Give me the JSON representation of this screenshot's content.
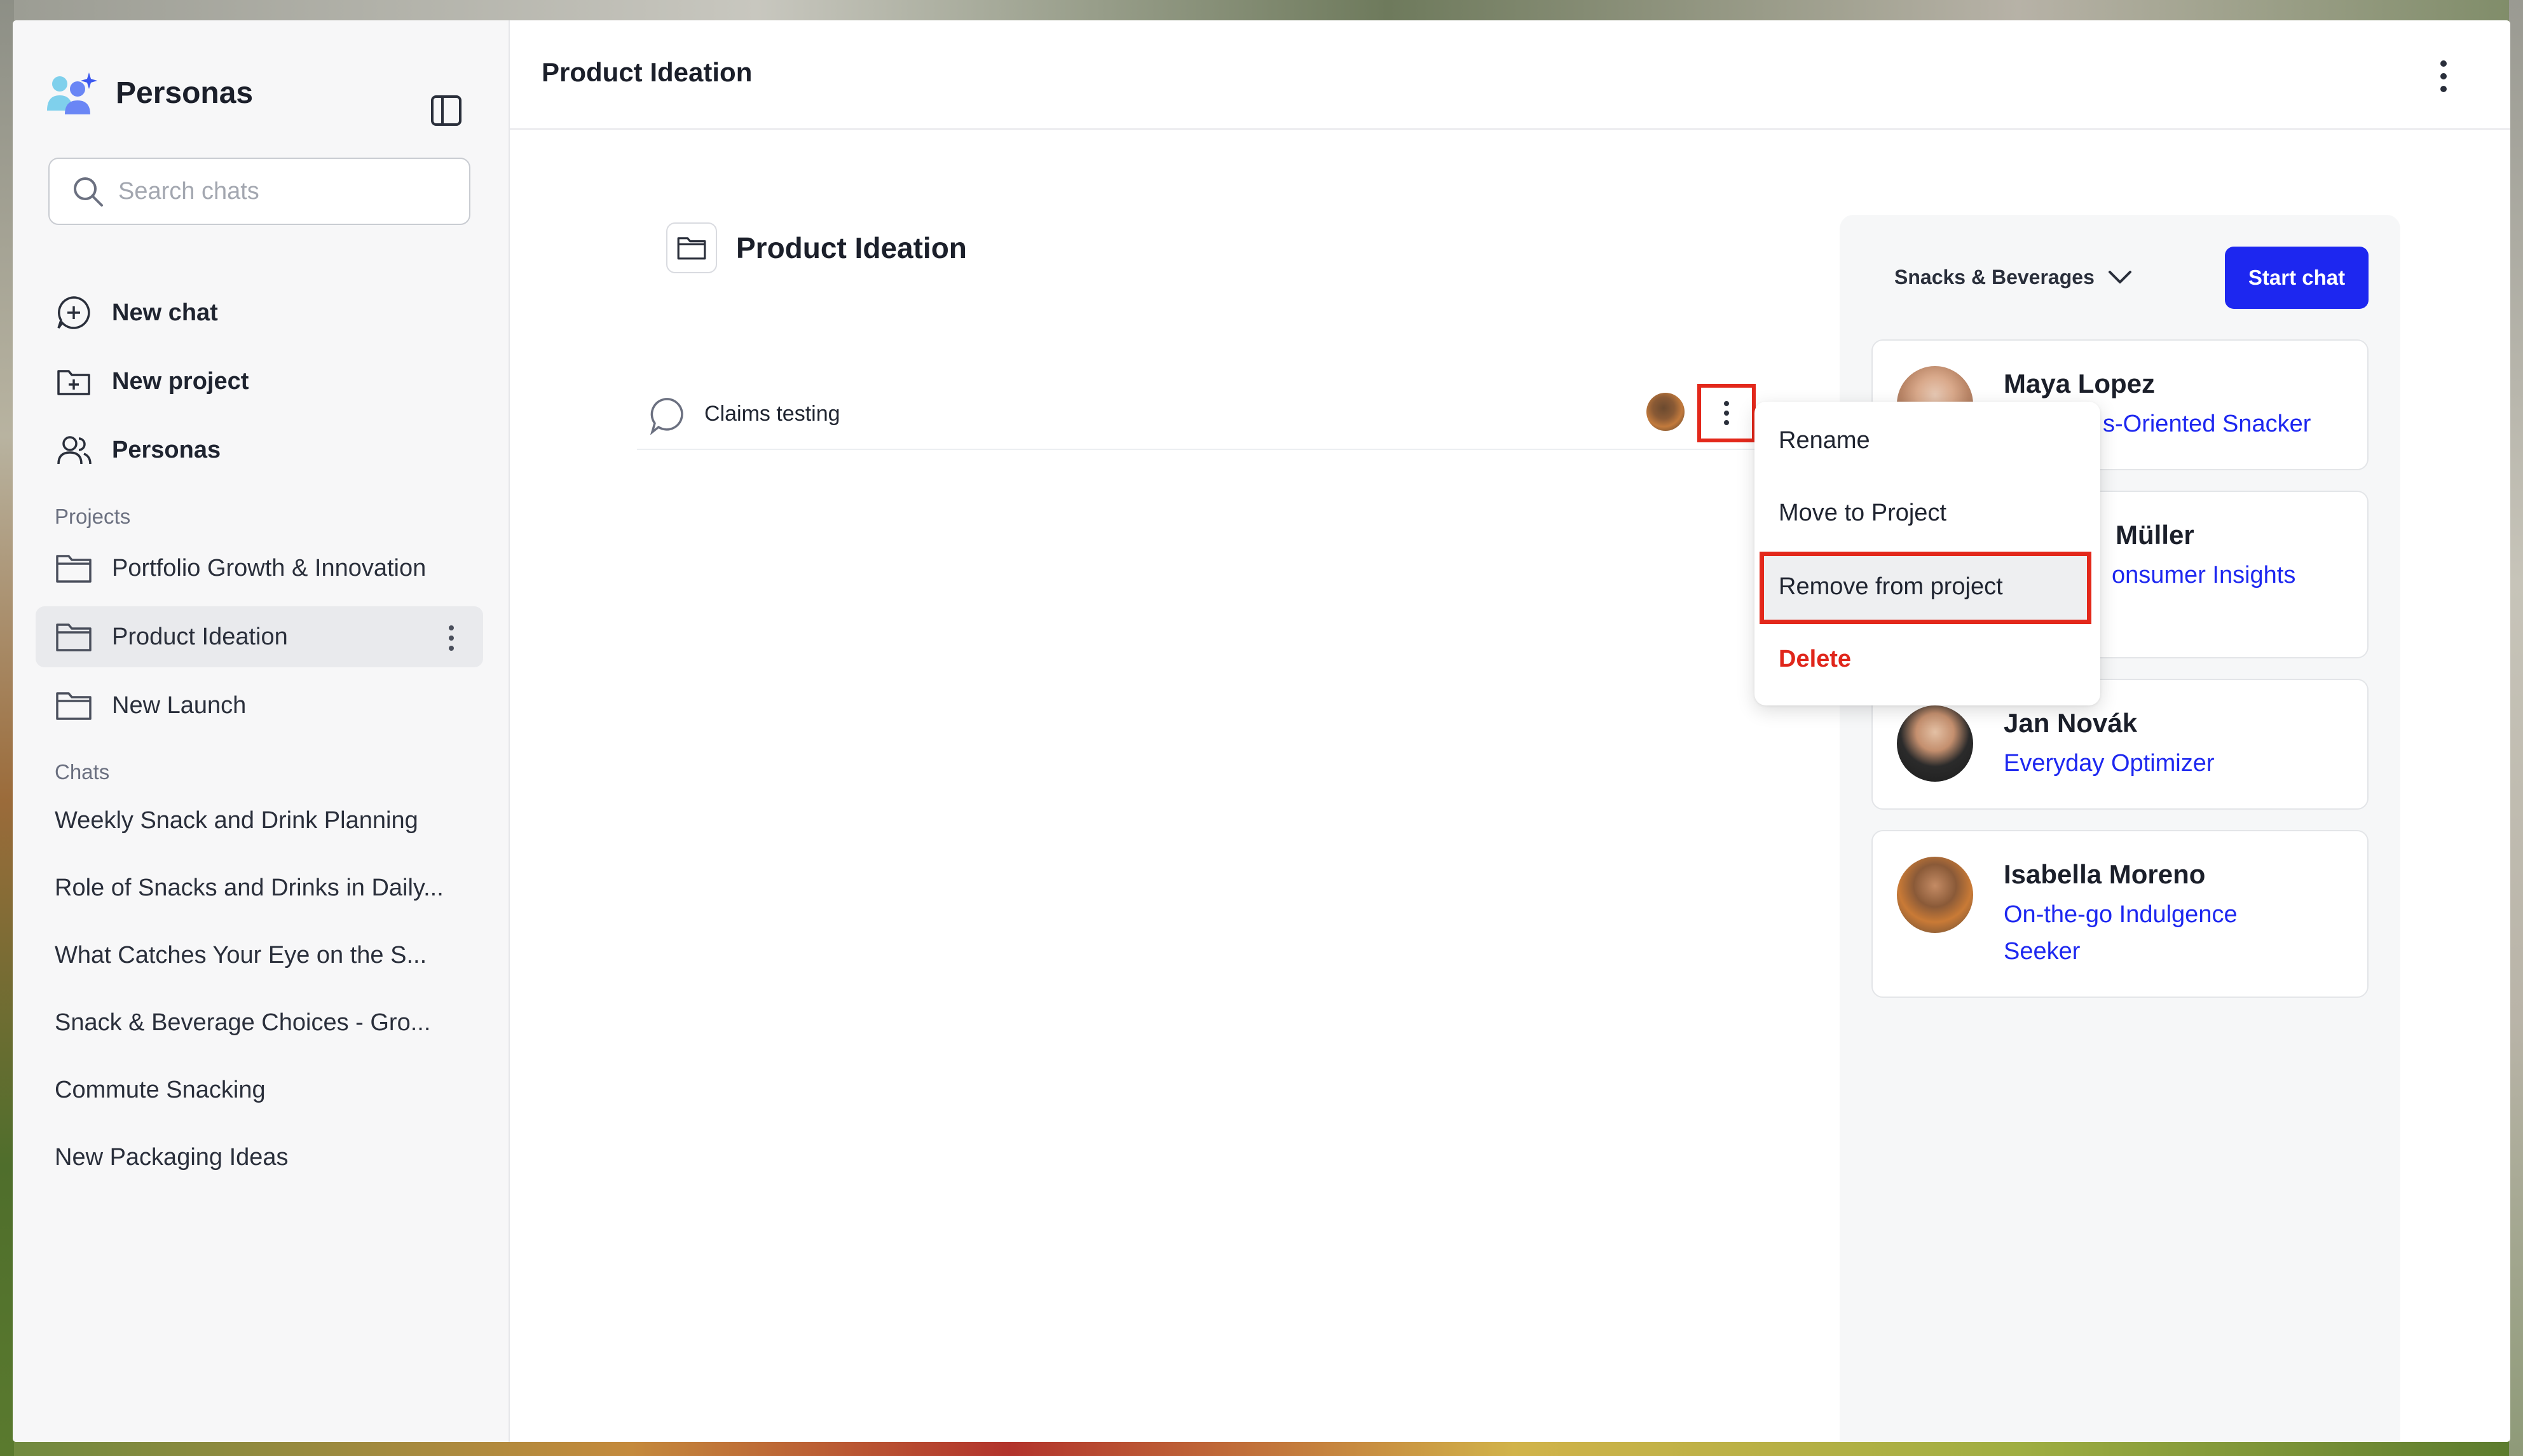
{
  "app": {
    "name": "Personas"
  },
  "search": {
    "placeholder": "Search chats"
  },
  "nav": {
    "new_chat": "New chat",
    "new_project": "New project",
    "personas": "Personas"
  },
  "sidebar": {
    "projects_label": "Projects",
    "projects": [
      {
        "label": "Portfolio Growth & Innovation"
      },
      {
        "label": "Product Ideation"
      },
      {
        "label": "New Launch"
      }
    ],
    "chats_label": "Chats",
    "chats": [
      {
        "label": "Weekly Snack and Drink Planning"
      },
      {
        "label": "Role of Snacks and Drinks in Daily..."
      },
      {
        "label": "What Catches Your Eye on the S..."
      },
      {
        "label": "Snack & Beverage Choices - Gro..."
      },
      {
        "label": "Commute Snacking"
      },
      {
        "label": "New Packaging Ideas"
      }
    ]
  },
  "header": {
    "title": "Product Ideation"
  },
  "project": {
    "title": "Product Ideation",
    "chats": [
      {
        "name": "Claims testing"
      }
    ]
  },
  "context_menu": {
    "items": [
      {
        "label": "Rename"
      },
      {
        "label": "Move to Project"
      },
      {
        "label": "Remove from project"
      },
      {
        "label": "Delete"
      }
    ]
  },
  "right_panel": {
    "segment": "Snacks & Beverages",
    "start_button": "Start chat",
    "personas": [
      {
        "name": "Maya Lopez",
        "role": "s-Oriented Snacker"
      },
      {
        "name": "Müller",
        "role": "onsumer Insights"
      },
      {
        "name": "Jan Novák",
        "role": "Everyday Optimizer"
      },
      {
        "name": "Isabella Moreno",
        "role": "On-the-go Indulgence Seeker"
      }
    ]
  },
  "colors": {
    "accent": "#1d27f0",
    "danger": "#e0261b",
    "highlight_outline": "#e3281b"
  }
}
